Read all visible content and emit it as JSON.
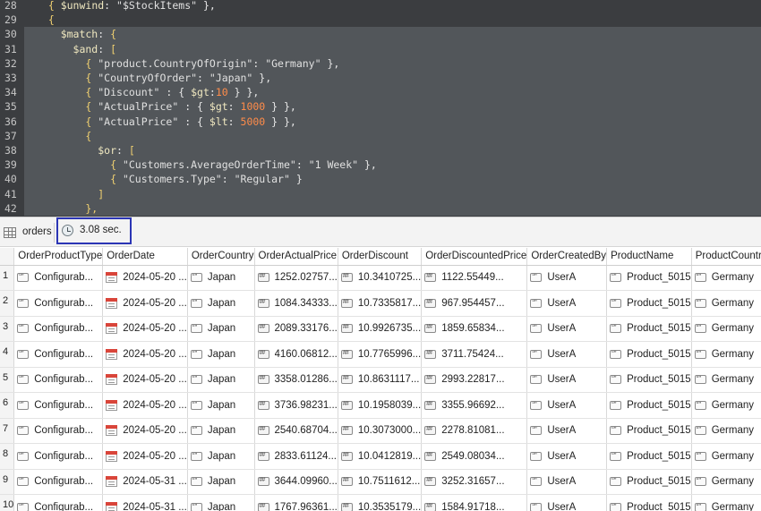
{
  "editor": {
    "lines": [
      {
        "num": "28",
        "tokens": [
          [
            "p",
            "  { "
          ],
          [
            "k",
            "$unwind"
          ],
          [
            "o",
            ": "
          ],
          [
            "s",
            "\"$StockItems\""
          ],
          [
            "o",
            " },"
          ]
        ]
      },
      {
        "num": "29",
        "tokens": [
          [
            "p",
            "  {"
          ]
        ]
      },
      {
        "num": "30",
        "tokens": [
          [
            "k",
            "    $match"
          ],
          [
            "o",
            ": "
          ],
          [
            "p",
            "{"
          ]
        ]
      },
      {
        "num": "31",
        "tokens": [
          [
            "k",
            "      $and"
          ],
          [
            "o",
            ": "
          ],
          [
            "p",
            "["
          ]
        ]
      },
      {
        "num": "32",
        "tokens": [
          [
            "p",
            "        { "
          ],
          [
            "s",
            "\"product.CountryOfOrigin\""
          ],
          [
            "o",
            ": "
          ],
          [
            "s",
            "\"Germany\""
          ],
          [
            "o",
            " },"
          ]
        ]
      },
      {
        "num": "33",
        "tokens": [
          [
            "p",
            "        { "
          ],
          [
            "s",
            "\"CountryOfOrder\""
          ],
          [
            "o",
            ": "
          ],
          [
            "s",
            "\"Japan\""
          ],
          [
            "o",
            " },"
          ]
        ]
      },
      {
        "num": "34",
        "tokens": [
          [
            "p",
            "        { "
          ],
          [
            "s",
            "\"Discount\""
          ],
          [
            "o",
            " : { "
          ],
          [
            "k",
            "$gt"
          ],
          [
            "o",
            ":"
          ],
          [
            "n",
            "10"
          ],
          [
            "o",
            " } },"
          ]
        ]
      },
      {
        "num": "35",
        "tokens": [
          [
            "p",
            "        { "
          ],
          [
            "s",
            "\"ActualPrice\""
          ],
          [
            "o",
            " : { "
          ],
          [
            "k",
            "$gt"
          ],
          [
            "o",
            ": "
          ],
          [
            "n",
            "1000"
          ],
          [
            "o",
            " } },"
          ]
        ]
      },
      {
        "num": "36",
        "tokens": [
          [
            "p",
            "        { "
          ],
          [
            "s",
            "\"ActualPrice\""
          ],
          [
            "o",
            " : { "
          ],
          [
            "k",
            "$lt"
          ],
          [
            "o",
            ": "
          ],
          [
            "n",
            "5000"
          ],
          [
            "o",
            " } },"
          ]
        ]
      },
      {
        "num": "37",
        "tokens": [
          [
            "p",
            "        {"
          ]
        ]
      },
      {
        "num": "38",
        "tokens": [
          [
            "k",
            "          $or"
          ],
          [
            "o",
            ": "
          ],
          [
            "p",
            "["
          ]
        ]
      },
      {
        "num": "39",
        "tokens": [
          [
            "p",
            "            { "
          ],
          [
            "s",
            "\"Customers.AverageOrderTime\""
          ],
          [
            "o",
            ": "
          ],
          [
            "s",
            "\"1 Week\""
          ],
          [
            "o",
            " },"
          ]
        ]
      },
      {
        "num": "40",
        "tokens": [
          [
            "p",
            "            { "
          ],
          [
            "s",
            "\"Customers.Type\""
          ],
          [
            "o",
            ": "
          ],
          [
            "s",
            "\"Regular\""
          ],
          [
            "o",
            " }"
          ]
        ]
      },
      {
        "num": "41",
        "tokens": [
          [
            "p",
            "          ]"
          ]
        ]
      },
      {
        "num": "42",
        "tokens": [
          [
            "p",
            "        },"
          ]
        ]
      }
    ]
  },
  "toolbar": {
    "collection": "orders",
    "timing": "3.08 sec.",
    "table_icon": "table-icon",
    "clock_icon": "clock-icon"
  },
  "grid": {
    "columns": [
      {
        "label": "OrderProductType",
        "type": "str",
        "width": 94
      },
      {
        "label": "OrderDate",
        "type": "date",
        "width": 94
      },
      {
        "label": "OrderCountry",
        "type": "str",
        "width": 95
      },
      {
        "label": "OrderActualPrice",
        "type": "num",
        "width": 94
      },
      {
        "label": "OrderDiscount",
        "type": "num",
        "width": 95
      },
      {
        "label": "OrderDiscountedPrice",
        "type": "num",
        "width": 94
      },
      {
        "label": "OrderCreatedBy",
        "type": "str",
        "width": 94
      },
      {
        "label": "ProductName",
        "type": "str",
        "width": 95
      },
      {
        "label": "ProductCountry",
        "type": "str",
        "width": 80
      }
    ],
    "rows": [
      {
        "n": "1",
        "cells": [
          "Configurab...",
          "2024-05-20 ...",
          "Japan",
          "1252.02757...",
          "10.3410725...",
          "1122.55449...",
          "UserA",
          "Product_5015",
          "Germany"
        ]
      },
      {
        "n": "2",
        "cells": [
          "Configurab...",
          "2024-05-20 ...",
          "Japan",
          "1084.34333...",
          "10.7335817...",
          "967.954457...",
          "UserA",
          "Product_5015",
          "Germany"
        ]
      },
      {
        "n": "3",
        "cells": [
          "Configurab...",
          "2024-05-20 ...",
          "Japan",
          "2089.33176...",
          "10.9926735...",
          "1859.65834...",
          "UserA",
          "Product_5015",
          "Germany"
        ]
      },
      {
        "n": "4",
        "cells": [
          "Configurab...",
          "2024-05-20 ...",
          "Japan",
          "4160.06812...",
          "10.7765996...",
          "3711.75424...",
          "UserA",
          "Product_5015",
          "Germany"
        ]
      },
      {
        "n": "5",
        "cells": [
          "Configurab...",
          "2024-05-20 ...",
          "Japan",
          "3358.01286...",
          "10.8631117...",
          "2993.22817...",
          "UserA",
          "Product_5015",
          "Germany"
        ]
      },
      {
        "n": "6",
        "cells": [
          "Configurab...",
          "2024-05-20 ...",
          "Japan",
          "3736.98231...",
          "10.1958039...",
          "3355.96692...",
          "UserA",
          "Product_5015",
          "Germany"
        ]
      },
      {
        "n": "7",
        "cells": [
          "Configurab...",
          "2024-05-20 ...",
          "Japan",
          "2540.68704...",
          "10.3073000...",
          "2278.81081...",
          "UserA",
          "Product_5015",
          "Germany"
        ]
      },
      {
        "n": "8",
        "cells": [
          "Configurab...",
          "2024-05-20 ...",
          "Japan",
          "2833.61124...",
          "10.0412819...",
          "2549.08034...",
          "UserA",
          "Product_5015",
          "Germany"
        ]
      },
      {
        "n": "9",
        "cells": [
          "Configurab...",
          "2024-05-31 ...",
          "Japan",
          "3644.09960...",
          "10.7511612...",
          "3252.31657...",
          "UserA",
          "Product_5015",
          "Germany"
        ]
      },
      {
        "n": "10",
        "cells": [
          "Configurab...",
          "2024-05-31 ...",
          "Japan",
          "1767.96361...",
          "10.3535179...",
          "1584.91718...",
          "UserA",
          "Product_5015",
          "Germany"
        ]
      }
    ]
  }
}
